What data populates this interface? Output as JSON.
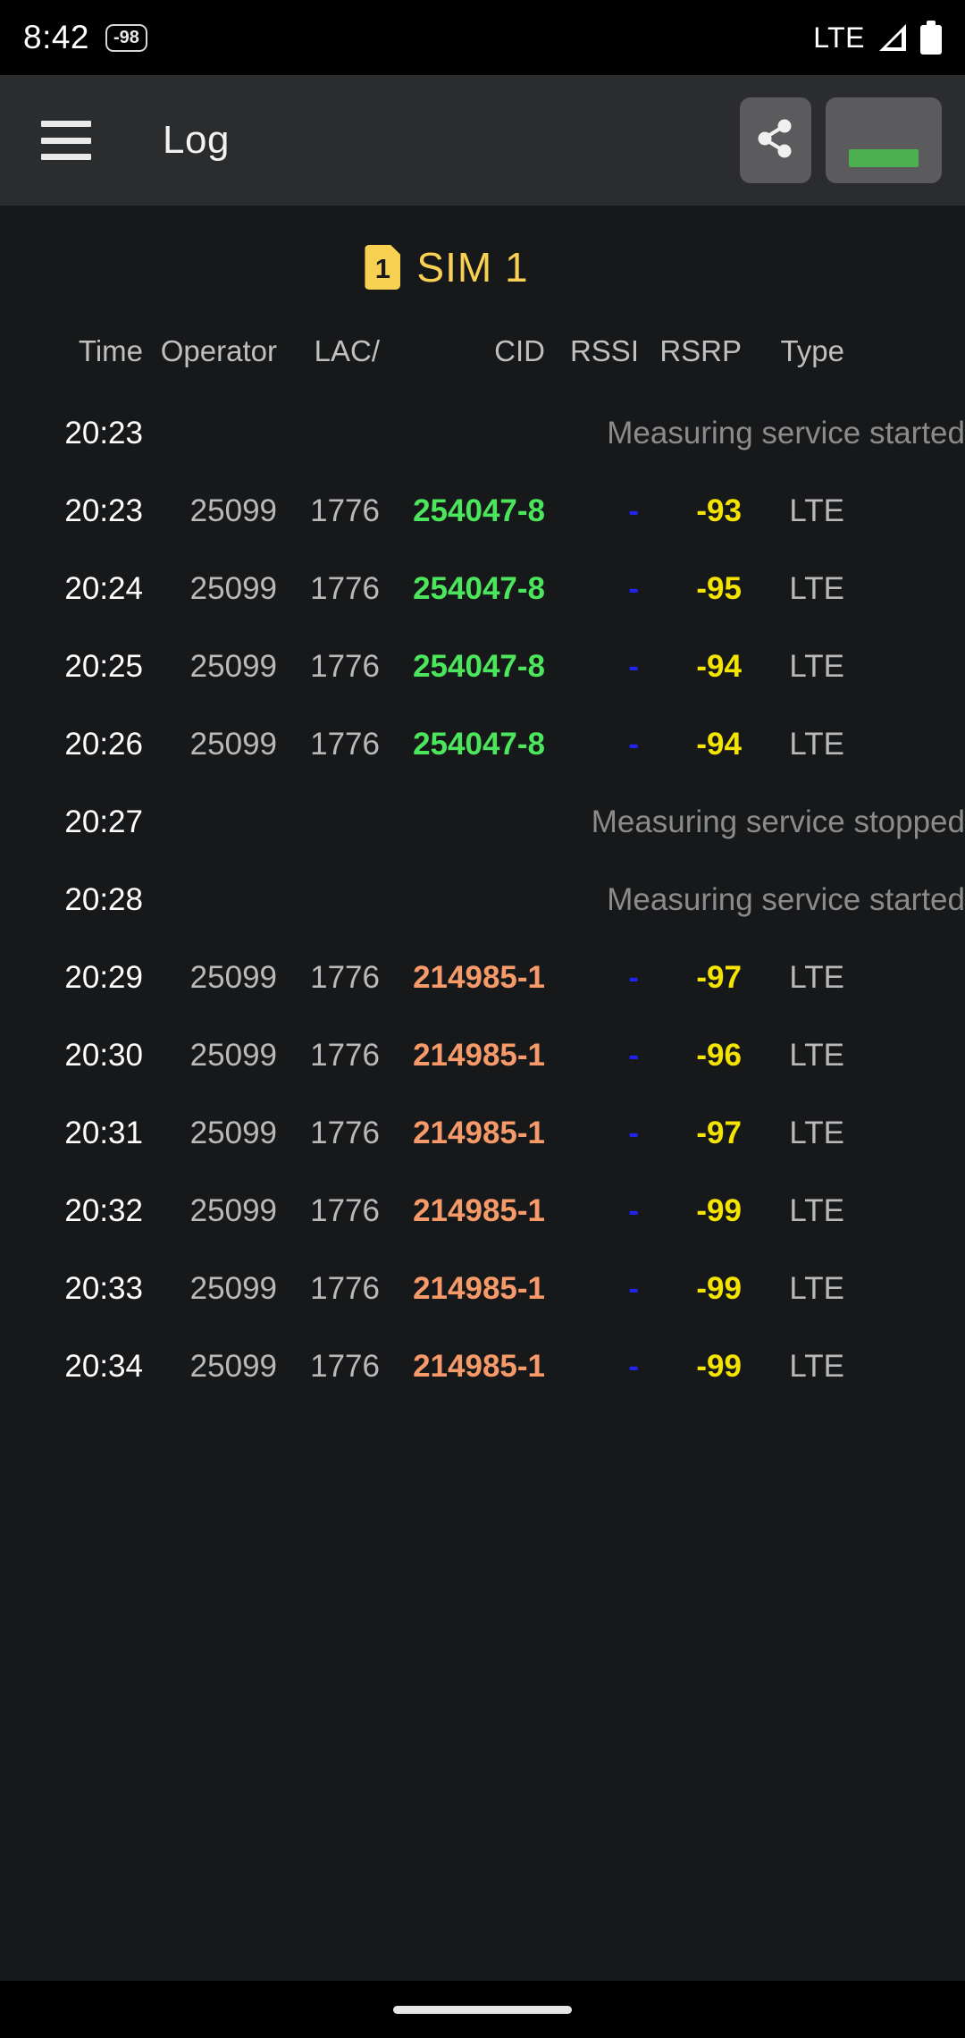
{
  "status_bar": {
    "clock": "8:42",
    "badge": "-98",
    "network": "LTE",
    "signal_icon": "signal-triangle-icon",
    "battery_icon": "battery-full-icon"
  },
  "toolbar": {
    "menu_icon": "hamburger-menu-icon",
    "title": "Log",
    "share_icon": "share-icon",
    "sim_toggle_label": ""
  },
  "sim_header": {
    "chip_number": "1",
    "label": "SIM 1",
    "color": "#f8d153"
  },
  "table": {
    "headers": {
      "time": "Time",
      "operator": "Operator",
      "lac": "LAC/",
      "cid": "CID",
      "rssi": "RSSI",
      "rsrp": "RSRP",
      "type": "Type"
    },
    "colors": {
      "cid_group_a": "#4ce65c",
      "cid_group_b": "#f79a6a",
      "rssi": "#2222ee",
      "rsrp": "#f4e400",
      "message": "#8b8b8b",
      "time": "#ffffff",
      "generic": "#b9b9b9"
    },
    "rows": [
      {
        "kind": "message",
        "time": "20:23",
        "message": "Measuring service started"
      },
      {
        "kind": "data",
        "time": "20:23",
        "operator": "25099",
        "lac": "1776",
        "cid": "254047-8",
        "cid_color": "#4ce65c",
        "rssi": "-",
        "rsrp": "-93",
        "type": "LTE"
      },
      {
        "kind": "data",
        "time": "20:24",
        "operator": "25099",
        "lac": "1776",
        "cid": "254047-8",
        "cid_color": "#4ce65c",
        "rssi": "-",
        "rsrp": "-95",
        "type": "LTE"
      },
      {
        "kind": "data",
        "time": "20:25",
        "operator": "25099",
        "lac": "1776",
        "cid": "254047-8",
        "cid_color": "#4ce65c",
        "rssi": "-",
        "rsrp": "-94",
        "type": "LTE"
      },
      {
        "kind": "data",
        "time": "20:26",
        "operator": "25099",
        "lac": "1776",
        "cid": "254047-8",
        "cid_color": "#4ce65c",
        "rssi": "-",
        "rsrp": "-94",
        "type": "LTE"
      },
      {
        "kind": "message",
        "time": "20:27",
        "message": "Measuring service stopped"
      },
      {
        "kind": "message",
        "time": "20:28",
        "message": "Measuring service started"
      },
      {
        "kind": "data",
        "time": "20:29",
        "operator": "25099",
        "lac": "1776",
        "cid": "214985-1",
        "cid_color": "#f79a6a",
        "rssi": "-",
        "rsrp": "-97",
        "type": "LTE"
      },
      {
        "kind": "data",
        "time": "20:30",
        "operator": "25099",
        "lac": "1776",
        "cid": "214985-1",
        "cid_color": "#f79a6a",
        "rssi": "-",
        "rsrp": "-96",
        "type": "LTE"
      },
      {
        "kind": "data",
        "time": "20:31",
        "operator": "25099",
        "lac": "1776",
        "cid": "214985-1",
        "cid_color": "#f79a6a",
        "rssi": "-",
        "rsrp": "-97",
        "type": "LTE"
      },
      {
        "kind": "data",
        "time": "20:32",
        "operator": "25099",
        "lac": "1776",
        "cid": "214985-1",
        "cid_color": "#f79a6a",
        "rssi": "-",
        "rsrp": "-99",
        "type": "LTE"
      },
      {
        "kind": "data",
        "time": "20:33",
        "operator": "25099",
        "lac": "1776",
        "cid": "214985-1",
        "cid_color": "#f79a6a",
        "rssi": "-",
        "rsrp": "-99",
        "type": "LTE"
      },
      {
        "kind": "data",
        "time": "20:34",
        "operator": "25099",
        "lac": "1776",
        "cid": "214985-1",
        "cid_color": "#f79a6a",
        "rssi": "-",
        "rsrp": "-99",
        "type": "LTE"
      }
    ]
  },
  "nav_bar": {
    "pill": "home-indicator"
  }
}
